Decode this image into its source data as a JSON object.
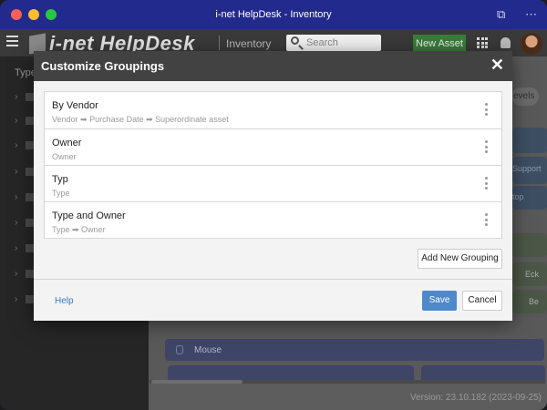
{
  "window": {
    "title": "i-net HelpDesk - Inventory"
  },
  "appbar": {
    "logo_text": "i-net HelpDesk",
    "section": "Inventory",
    "search_placeholder": "Search",
    "new_asset_label": "New Asset"
  },
  "sidebar": {
    "header": "Type"
  },
  "background": {
    "levels_label": "evels",
    "support_label": "Support",
    "top_label": "top",
    "eck_label": "Eck",
    "be_label": "Be",
    "mouse_label": "Mouse",
    "version": "Version: 23.10.182 (2023-09-25)"
  },
  "modal": {
    "title": "Customize Groupings",
    "groupings": [
      {
        "name": "By Vendor",
        "path": "Vendor ➡ Purchase Date ➡ Superordinate asset"
      },
      {
        "name": "Owner",
        "path": "Owner"
      },
      {
        "name": "Typ",
        "path": "Type"
      },
      {
        "name": "Type and Owner",
        "path": "Type ➡ Owner"
      }
    ],
    "add_grouping_label": "Add New Grouping",
    "help_label": "Help",
    "save_label": "Save",
    "cancel_label": "Cancel"
  },
  "colors": {
    "titlebar": "#232a8e",
    "primary_button": "#4e89c9",
    "new_asset": "#3a7d3a"
  }
}
